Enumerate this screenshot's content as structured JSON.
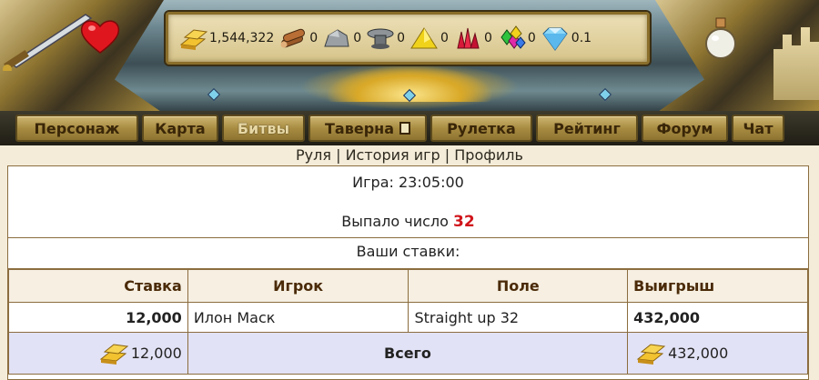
{
  "resources": {
    "gold": "1,544,322",
    "wood": "0",
    "stone": "0",
    "iron": "0",
    "sulfur": "0",
    "rubies": "0",
    "gems": "0",
    "diamonds": "0.1"
  },
  "nav": {
    "items": [
      {
        "label": "Персонаж"
      },
      {
        "label": "Карта"
      },
      {
        "label": "Битвы"
      },
      {
        "label": "Таверна"
      },
      {
        "label": "Рулетка"
      },
      {
        "label": "Рейтинг"
      },
      {
        "label": "Форум"
      },
      {
        "label": "Чат"
      }
    ]
  },
  "sublinks": {
    "roulette": "Руля",
    "history": "История игр",
    "profile": "Профиль",
    "separator": "|"
  },
  "game": {
    "time_label": "Игра: 23:05:00",
    "result_label": "Выпало число",
    "result_number": "32",
    "bets_title": "Ваши ставки:"
  },
  "table": {
    "headers": [
      "Ставка",
      "Игрок",
      "Поле",
      "Выигрыш"
    ],
    "rows": [
      {
        "stake": "12,000",
        "player": "Илон Маск",
        "field": "Straight up 32",
        "win": "432,000"
      }
    ],
    "total": {
      "stake": "12,000",
      "label": "Всего",
      "win": "432,000"
    }
  },
  "colors": {
    "accent_red": "#d0141a",
    "nav_gold": "#a88c42",
    "table_border": "#8b6d3f",
    "total_row_bg": "#e2e2f6"
  }
}
